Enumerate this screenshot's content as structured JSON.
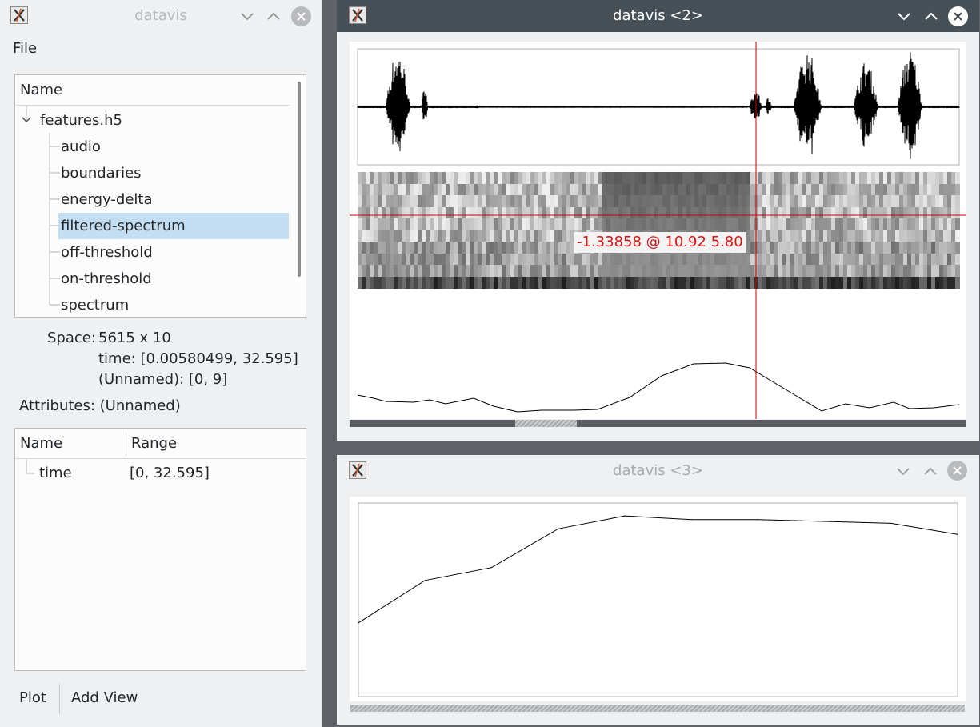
{
  "windows": {
    "main": {
      "title": "datavis"
    },
    "plot2": {
      "title": "datavis <2>"
    },
    "plot3": {
      "title": "datavis <3>"
    }
  },
  "menu": {
    "file": "File"
  },
  "tree": {
    "header": "Name",
    "root": "features.h5",
    "items": [
      "audio",
      "boundaries",
      "energy-delta",
      "filtered-spectrum",
      "off-threshold",
      "on-threshold",
      "spectrum"
    ],
    "selected": "filtered-spectrum"
  },
  "info": {
    "space_label": "Space:",
    "space_value": "5615 x 10",
    "dim1": "time:  [0.00580499, 32.595]",
    "dim2": "(Unnamed):  [0, 9]",
    "attributes": "Attributes: (Unnamed)"
  },
  "attr_table": {
    "columns": [
      "Name",
      "Range"
    ],
    "rows": [
      {
        "name": "time",
        "range": "[0, 32.595]"
      }
    ]
  },
  "buttons": {
    "plot": "Plot",
    "add_view": "Add View"
  },
  "plot2": {
    "cursor_readout": "-1.33858 @ 10.92 5.80",
    "scroll_fraction": 0.1
  },
  "colors": {
    "accent_titlebar": "#475057",
    "selection": "#c3def3",
    "cursor": "#cc0000"
  },
  "chart_data": [
    {
      "type": "line",
      "series": [
        {
          "values": [
            0.4,
            0.63,
            0.7,
            0.91,
            0.98,
            0.96,
            0.96,
            0.95,
            0.94,
            0.88
          ]
        }
      ],
      "ylim": [
        0,
        1.05
      ]
    }
  ]
}
